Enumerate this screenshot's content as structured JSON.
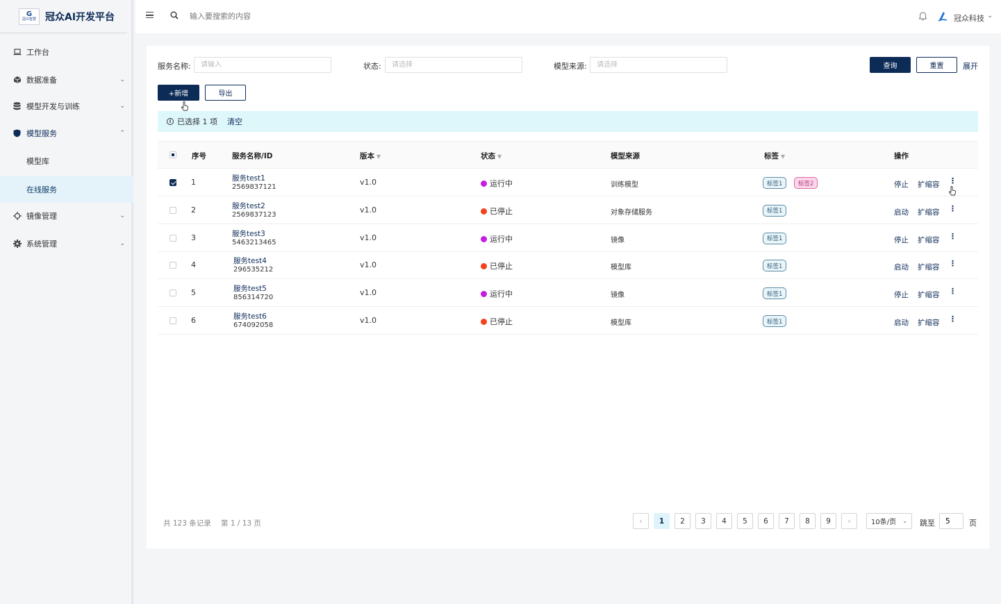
{
  "app": {
    "title": "冠众AI开发平台",
    "logo_text": "冠众智慧"
  },
  "sidebar": {
    "items": [
      {
        "label": "工作台",
        "icon": "laptop-icon"
      },
      {
        "label": "数据准备",
        "icon": "cube-icon"
      },
      {
        "label": "模型开发与训练",
        "icon": "database-icon"
      },
      {
        "label": "模型服务",
        "icon": "shield-icon"
      },
      {
        "label": "模型库"
      },
      {
        "label": "在线服务"
      },
      {
        "label": "镜像管理",
        "icon": "crosshair-icon"
      },
      {
        "label": "系统管理",
        "icon": "gear-icon"
      }
    ]
  },
  "topbar": {
    "search_placeholder": "输入要搜索的内容",
    "company": "冠众科技"
  },
  "filters": {
    "service_name_label": "服务名称:",
    "service_name_placeholder": "请输入",
    "status_label": "状态:",
    "status_placeholder": "请选择",
    "source_label": "模型来源:",
    "source_placeholder": "请选择",
    "query": "查询",
    "reset": "重置",
    "expand": "展开"
  },
  "actions": {
    "add": "+新增",
    "export": "导出"
  },
  "selection": {
    "text": "已选择 1 项",
    "clear": "清空"
  },
  "table": {
    "headers": {
      "index": "序号",
      "name": "服务名称/ID",
      "version": "版本",
      "status": "状态",
      "source": "模型来源",
      "tags": "标签",
      "ops": "操作"
    },
    "rows": [
      {
        "index": "1",
        "name": "服务test1",
        "id": "2569837121",
        "version": "v1.0",
        "status": "运行中",
        "status_color": "#c21fe0",
        "source": "训练模型",
        "tags": [
          "标签1",
          "标签2"
        ],
        "op1": "停止",
        "op2": "扩缩容",
        "checked": true
      },
      {
        "index": "2",
        "name": "服务test2",
        "id": "2569837123",
        "version": "v1.0",
        "status": "已停止",
        "status_color": "#f2411e",
        "source": "对象存储服务",
        "tags": [
          "标签1"
        ],
        "op1": "启动",
        "op2": "扩缩容",
        "checked": false
      },
      {
        "index": "3",
        "name": "服务test3",
        "id": "5463213465",
        "version": "v1.0",
        "status": "运行中",
        "status_color": "#c21fe0",
        "source": "镜像",
        "tags": [
          "标签1"
        ],
        "op1": "停止",
        "op2": "扩缩容",
        "checked": false
      },
      {
        "index": "4",
        "name": "服务test4",
        "id": "296535212",
        "version": "v1.0",
        "status": "已停止",
        "status_color": "#f2411e",
        "source": "模型库",
        "tags": [
          "标签1"
        ],
        "op1": "启动",
        "op2": "扩缩容",
        "checked": false
      },
      {
        "index": "5",
        "name": "服务test5",
        "id": "856314720",
        "version": "v1.0",
        "status": "运行中",
        "status_color": "#c21fe0",
        "source": "镜像",
        "tags": [
          "标签1"
        ],
        "op1": "停止",
        "op2": "扩缩容",
        "checked": false
      },
      {
        "index": "6",
        "name": "服务test6",
        "id": "674092058",
        "version": "v1.0",
        "status": "已停止",
        "status_color": "#f2411e",
        "source": "模型库",
        "tags": [
          "标签1"
        ],
        "op1": "启动",
        "op2": "扩缩容",
        "checked": false
      }
    ]
  },
  "pagination": {
    "total": "共 123 条记录",
    "current": "第 1 / 13 页",
    "pages": [
      "1",
      "2",
      "3",
      "4",
      "5",
      "6",
      "7",
      "8",
      "9"
    ],
    "active_page": "1",
    "page_size": "10条/页",
    "jump_label": "跳至",
    "jump_value": "5",
    "jump_suffix": "页"
  },
  "colors": {
    "primary": "#0d2b57",
    "highlight": "#def7fb",
    "running": "#c21fe0",
    "stopped": "#f2411e"
  }
}
